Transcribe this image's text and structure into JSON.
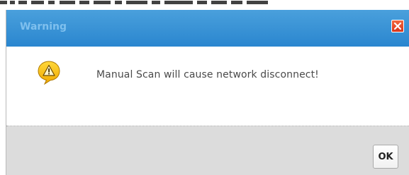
{
  "dialog": {
    "title": "Warning",
    "message": "Manual Scan will cause network disconnect!",
    "ok_label": "OK",
    "icons": {
      "close": "close-icon",
      "warning": "warning-icon"
    },
    "colors": {
      "titlebar": "#2a86cf",
      "title_text": "#7fc0ee",
      "close_button": "#e04a28",
      "warning_icon": "#f5b800",
      "footer": "#dcdcdc"
    }
  }
}
